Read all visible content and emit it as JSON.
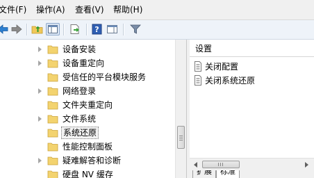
{
  "menu": [
    "文件(F)",
    "操作(A)",
    "查看(V)",
    "帮助(H)"
  ],
  "toolbar": {
    "buttons": [
      "back-arrow-icon",
      "forward-arrow-icon",
      "up-folder-icon",
      "show-hide-tree-icon",
      "export-list-icon",
      "help-icon",
      "properties-pane-icon",
      "filter-icon"
    ]
  },
  "tree": {
    "items": [
      {
        "label": "设备安装",
        "expandable": true
      },
      {
        "label": "设备重定向",
        "expandable": true
      },
      {
        "label": "受信任的平台模块服务",
        "expandable": false
      },
      {
        "label": "网络登录",
        "expandable": true
      },
      {
        "label": "文件夹重定向",
        "expandable": false
      },
      {
        "label": "文件系统",
        "expandable": true
      },
      {
        "label": "系统还原",
        "expandable": false,
        "selected": true
      },
      {
        "label": "性能控制面板",
        "expandable": false
      },
      {
        "label": "疑难解答和诊断",
        "expandable": true
      },
      {
        "label": "硬盘 NV 缓存",
        "expandable": false
      }
    ]
  },
  "details": {
    "header": "设置",
    "items": [
      "关闭配置",
      "关闭系统还原"
    ]
  },
  "tabs": [
    "扩展",
    "标准"
  ],
  "colors": {
    "folder": "#f3d36f",
    "accent": "#3d6fb4"
  }
}
